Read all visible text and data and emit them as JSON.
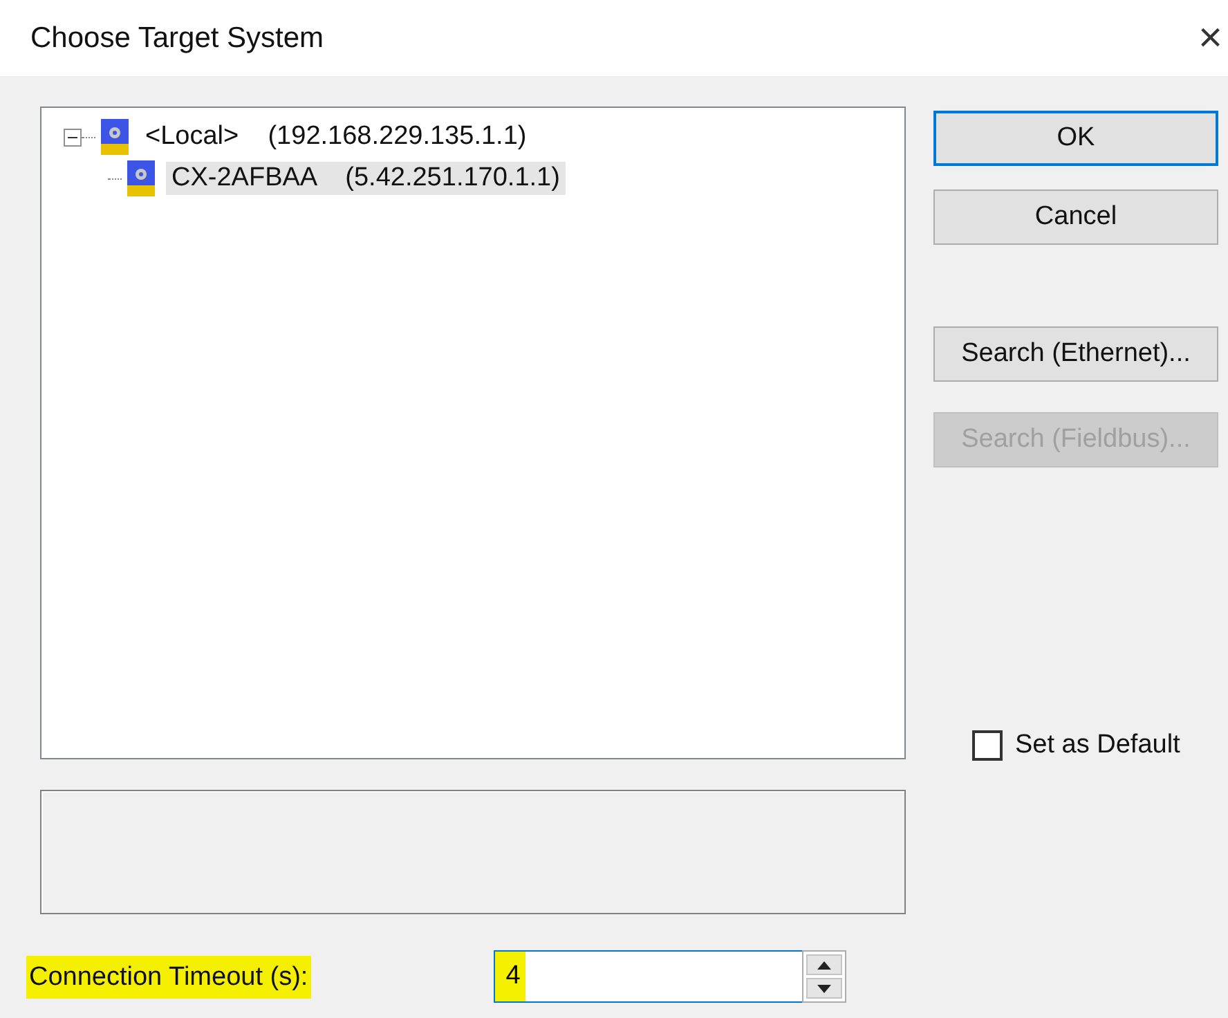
{
  "window": {
    "title": "Choose Target System",
    "close": "×"
  },
  "tree": [
    {
      "name": "<Local>",
      "address": "(192.168.229.135.1.1)",
      "expanded": true,
      "selected": false,
      "children": [
        {
          "name": "CX-2AFBAA",
          "address": "(5.42.251.170.1.1)",
          "selected": true
        }
      ]
    }
  ],
  "buttons": [
    {
      "label": "OK",
      "default": true,
      "disabled": false
    },
    {
      "label": "Cancel",
      "default": false,
      "disabled": false
    },
    {
      "label": "Search (Ethernet)...",
      "default": false,
      "disabled": false
    },
    {
      "label": "Search (Fieldbus)...",
      "default": false,
      "disabled": true
    }
  ],
  "set_as_default": {
    "label": "Set as Default",
    "checked": false
  },
  "timeout": {
    "label": "Connection Timeout (s):",
    "value": "4",
    "highlighted": true
  }
}
